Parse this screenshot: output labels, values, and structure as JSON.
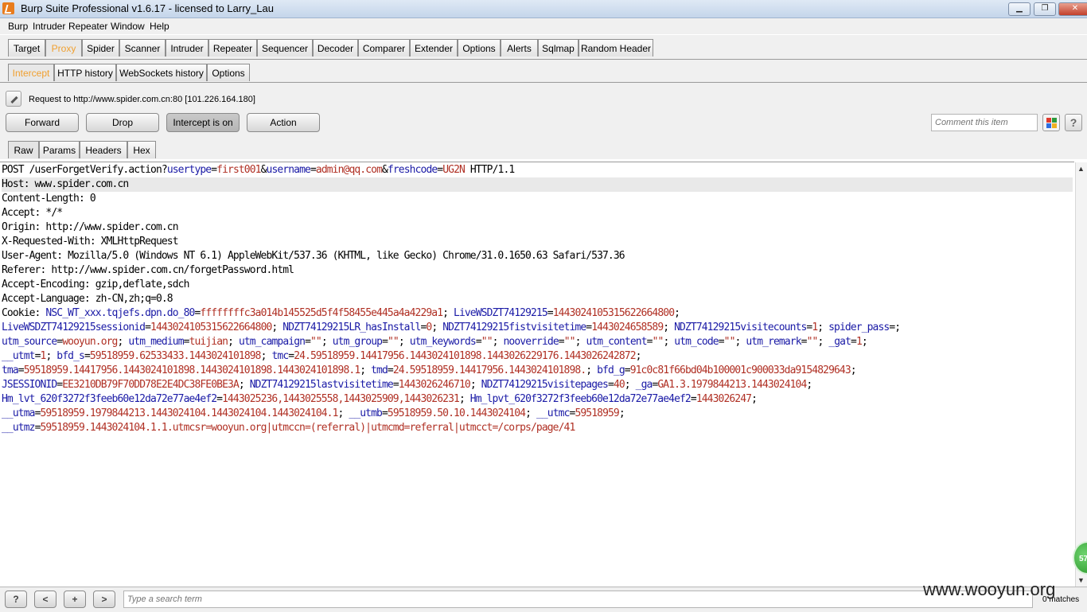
{
  "window": {
    "title": "Burp Suite Professional v1.6.17 - licensed to Larry_Lau",
    "minimize": "▁",
    "restore": "❐",
    "close": "✕"
  },
  "menu": [
    "Burp",
    "Intruder",
    "Repeater",
    "Window",
    "Help"
  ],
  "main_tabs": [
    "Target",
    "Proxy",
    "Spider",
    "Scanner",
    "Intruder",
    "Repeater",
    "Sequencer",
    "Decoder",
    "Comparer",
    "Extender",
    "Options",
    "Alerts",
    "Sqlmap",
    "Random Header"
  ],
  "main_tab_selected": "Proxy",
  "sub_tabs": [
    "Intercept",
    "HTTP history",
    "WebSockets history",
    "Options"
  ],
  "request_label": "Request to http://www.spider.com.cn:80  [101.226.164.180]",
  "buttons": {
    "forward": "Forward",
    "drop": "Drop",
    "intercept": "Intercept is on",
    "action": "Action"
  },
  "comment_placeholder": "Comment this item",
  "help_label": "?",
  "view_tabs": [
    "Raw",
    "Params",
    "Headers",
    "Hex"
  ],
  "request_lines": [
    "POST /userForgetVerify.action?",
    "usertype",
    "first001",
    "username",
    "admin@qq.com",
    "freshcode",
    "UG2N",
    " HTTP/1.1",
    "Host: www.spider.com.cn",
    "Content-Length: 0",
    "Accept: */*",
    "Origin: http://www.spider.com.cn",
    "X-Requested-With: XMLHttpRequest",
    "User-Agent: Mozilla/5.0 (Windows NT 6.1) AppleWebKit/537.36 (KHTML, like Gecko) Chrome/31.0.1650.63 Safari/537.36",
    "Referer: http://www.spider.com.cn/forgetPassword.html",
    "Accept-Encoding: gzip,deflate,sdch",
    "Accept-Language: zh-CN,zh;q=0.8",
    "Cookie: "
  ],
  "cookie_rows": [
    [
      [
        "NSC_WT_xxx.tqjefs.dpn.do_80",
        "ffffffffc3a014b145525d5f4f58455e445a4a4229a1"
      ],
      [
        "LiveWSDZT74129215",
        "1443024105315622664800"
      ]
    ],
    [
      [
        "LiveWSDZT74129215sessionid",
        "1443024105315622664800"
      ],
      [
        "NDZT74129215LR_hasInstall",
        "0"
      ],
      [
        "NDZT74129215fistvisitetime",
        "1443024658589"
      ],
      [
        "NDZT74129215visitecounts",
        "1"
      ],
      [
        "spider_pass",
        ""
      ]
    ],
    [
      [
        "utm_source",
        "wooyun.org"
      ],
      [
        "utm_medium",
        "tuijian"
      ],
      [
        "utm_campaign",
        "\"\""
      ],
      [
        "utm_group",
        "\"\""
      ],
      [
        "utm_keywords",
        "\"\""
      ],
      [
        "nooverride",
        "\"\""
      ],
      [
        "utm_content",
        "\"\""
      ],
      [
        "utm_code",
        "\"\""
      ],
      [
        "utm_remark",
        "\"\""
      ],
      [
        "_gat",
        "1"
      ]
    ],
    [
      [
        "__utmt",
        "1"
      ],
      [
        "bfd_s",
        "59518959.62533433.1443024101898"
      ],
      [
        "tmc",
        "24.59518959.14417956.1443024101898.1443026229176.1443026242872"
      ]
    ],
    [
      [
        "tma",
        "59518959.14417956.1443024101898.1443024101898.1443024101898.1"
      ],
      [
        "tmd",
        "24.59518959.14417956.1443024101898."
      ],
      [
        "bfd_g",
        "91c0c81f66bd04b100001c900033da9154829643"
      ]
    ],
    [
      [
        "JSESSIONID",
        "EE3210DB79F70DD78E2E4DC38FE0BE3A"
      ],
      [
        "NDZT74129215lastvisitetime",
        "1443026246710"
      ],
      [
        "NDZT74129215visitepages",
        "40"
      ],
      [
        "_ga",
        "GA1.3.1979844213.1443024104"
      ]
    ],
    [
      [
        "Hm_lvt_620f3272f3feeb60e12da72e77ae4ef2",
        "1443025236,1443025558,1443025909,1443026231"
      ],
      [
        "Hm_lpvt_620f3272f3feeb60e12da72e77ae4ef2",
        "1443026247"
      ]
    ],
    [
      [
        "__utma",
        "59518959.1979844213.1443024104.1443024104.1443024104.1"
      ],
      [
        "__utmb",
        "59518959.50.10.1443024104"
      ],
      [
        "__utmc",
        "59518959"
      ]
    ],
    [
      [
        "__utmz",
        "59518959.1443024104.1.1.utmcsr=wooyun.org|utmccn=(referral)|utmcmd=referral|utmcct=/corps/page/41"
      ]
    ]
  ],
  "search": {
    "help": "?",
    "prev": "<",
    "add": "+",
    "next": ">",
    "placeholder": "Type a search term",
    "matches": "0 matches"
  },
  "watermark": "www.wooyun.org",
  "badge": "57",
  "colors": {
    "param_name": "#1a1aa6",
    "param_value": "#b03024",
    "selected_tab_text": "#f0a030"
  }
}
